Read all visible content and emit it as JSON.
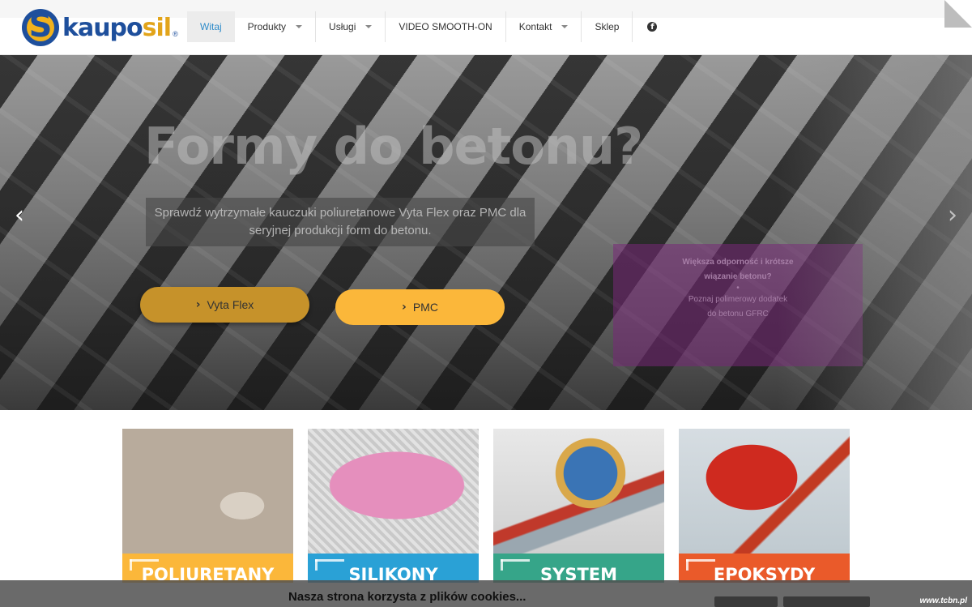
{
  "brand": {
    "name_part1": "kaupo",
    "name_part2": "sil",
    "reg": "®"
  },
  "nav": {
    "items": [
      {
        "label": "Witaj",
        "active": true,
        "dropdown": false
      },
      {
        "label": "Produkty",
        "active": false,
        "dropdown": true
      },
      {
        "label": "Usługi",
        "active": false,
        "dropdown": true
      },
      {
        "label": "VIDEO SMOOTH-ON",
        "active": false,
        "dropdown": false
      },
      {
        "label": "Kontakt",
        "active": false,
        "dropdown": true
      },
      {
        "label": "Sklep",
        "active": false,
        "dropdown": false
      }
    ],
    "facebook_icon": "facebook-icon"
  },
  "hero": {
    "title": "Formy do betonu?",
    "subtitle": "Sprawdź wytrzymałe kauczuki poliuretanowe Vyta Flex oraz PMC dla seryjnej produkcji form do betonu.",
    "buttons": [
      {
        "label": "Vyta Flex"
      },
      {
        "label": "PMC"
      }
    ],
    "promo": {
      "line1": "Większa odporność i krótsze",
      "line2": "wiązanie betonu?",
      "line3": "Poznaj polimerowy dodatek",
      "line4": "do betonu GFRC"
    },
    "prev_icon": "chevron-left-icon",
    "next_icon": "chevron-right-icon"
  },
  "categories": [
    {
      "label": "POLIURETANY",
      "color": "#fbb73a"
    },
    {
      "label": "SILIKONY",
      "color": "#2aa1d6"
    },
    {
      "label": "SYSTEM",
      "color": "#36a589"
    },
    {
      "label": "EPOKSYDY",
      "color": "#ea5a2a"
    }
  ],
  "cookie": {
    "text": "Nasza strona korzysta z plików cookies..."
  },
  "watermark": "www.tcbn.pl"
}
